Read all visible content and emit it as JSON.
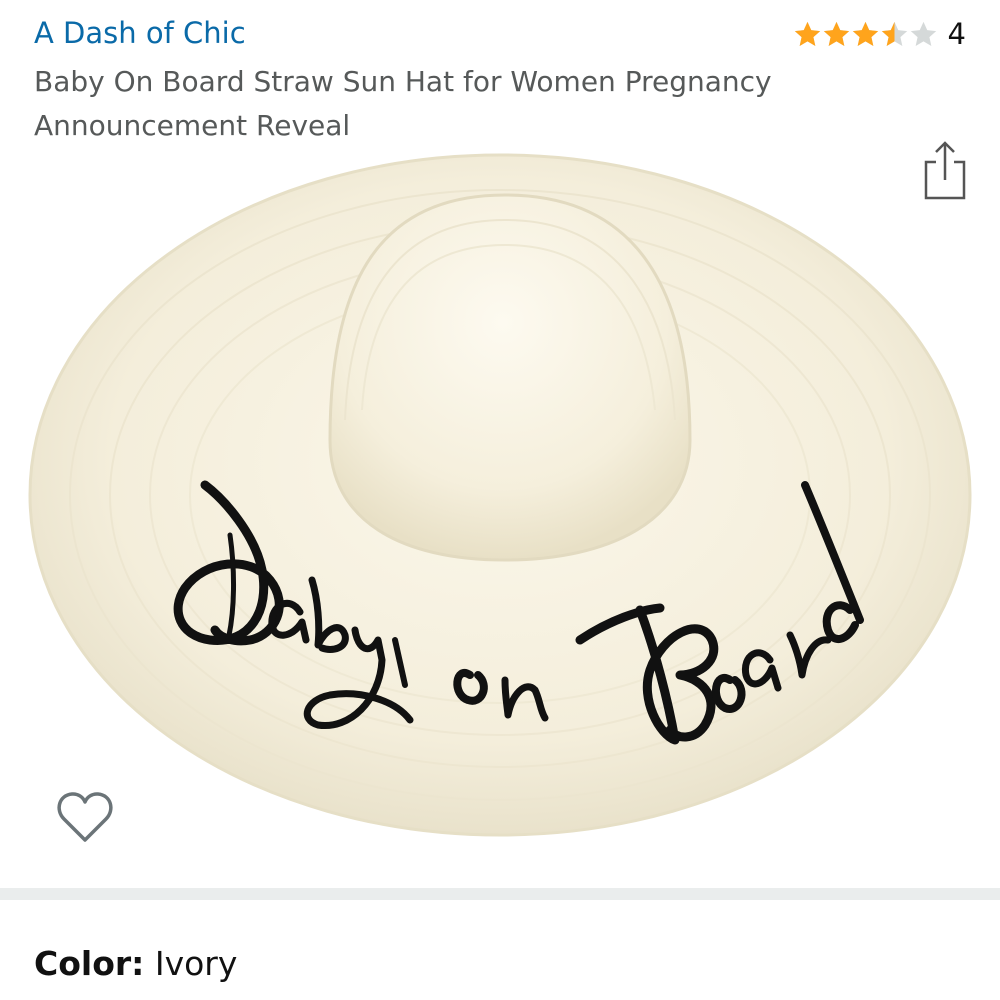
{
  "brand": {
    "name": "A Dash of Chic"
  },
  "rating": {
    "stars": 3.5,
    "max": 5,
    "count": "4",
    "filled_color": "#ffa41c",
    "empty_color": "#d5d9d9"
  },
  "product": {
    "title": "Baby On Board Straw Sun Hat for Women Pregnancy Announcement Reveal"
  },
  "image": {
    "hat_text": "Baby on Board"
  },
  "icons": {
    "share": "share-icon",
    "wishlist": "heart-outline-icon"
  },
  "color_selection": {
    "label": "Color:",
    "value": "Ivory"
  },
  "colors": {
    "brand_link": "#0a6aa8",
    "hat": "#f6f1df",
    "divider": "#eaeded"
  }
}
